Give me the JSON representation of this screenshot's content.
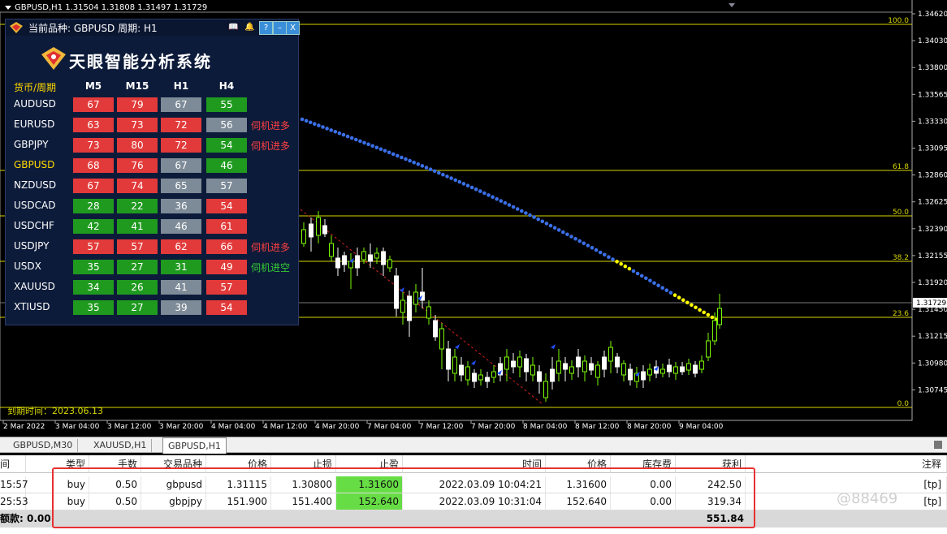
{
  "chart": {
    "header": "GBPUSD,H1  1.31504 1.31808 1.31497 1.31729",
    "price_labels": [
      "1.34620",
      "1.34030",
      "1.33800",
      "1.33565",
      "1.33330",
      "1.33095",
      "1.32860",
      "1.32625",
      "1.32390",
      "1.32155",
      "1.31920",
      "1.31729",
      "1.31450",
      "1.31215",
      "1.30980",
      "1.30745"
    ],
    "current_price": "1.31729",
    "fib_levels": [
      {
        "label": "100.0"
      },
      {
        "label": "61.8"
      },
      {
        "label": "50.0"
      },
      {
        "label": "38.2"
      },
      {
        "label": "23.6"
      },
      {
        "label": "0.0"
      }
    ],
    "time_labels": [
      "2 Mar 2022",
      "3 Mar 04:00",
      "3 Mar 12:00",
      "3 Mar 20:00",
      "4 Mar 04:00",
      "4 Mar 12:00",
      "4 Mar 20:00",
      "7 Mar 04:00",
      "7 Mar 12:00",
      "7 Mar 20:00",
      "8 Mar 04:00",
      "8 Mar 12:00",
      "8 Mar 20:00",
      "9 Mar 04:00"
    ],
    "colors": {
      "bull": "#7cfc00",
      "bear": "#ffffff",
      "fib": "#d6d600",
      "dots": "#3a6fe8",
      "dots_hi": "#ffff00",
      "trend": "#d02020"
    }
  },
  "panel": {
    "title": "当前品种: GBPUSD 周期: H1",
    "brand": "天眼智能分析系统",
    "col_header": "货币/周期",
    "columns": [
      "M5",
      "M15",
      "H1",
      "H4"
    ],
    "rows": [
      {
        "symbol": "AUDUSD",
        "cells": [
          {
            "v": "67",
            "c": "red"
          },
          {
            "v": "79",
            "c": "red"
          },
          {
            "v": "67",
            "c": "gray"
          },
          {
            "v": "55",
            "c": "green"
          }
        ],
        "note": ""
      },
      {
        "symbol": "EURUSD",
        "cells": [
          {
            "v": "63",
            "c": "red"
          },
          {
            "v": "73",
            "c": "red"
          },
          {
            "v": "72",
            "c": "red"
          },
          {
            "v": "56",
            "c": "gray"
          }
        ],
        "note": "伺机进多",
        "note_color": "#ff4040"
      },
      {
        "symbol": "GBPJPY",
        "cells": [
          {
            "v": "73",
            "c": "red"
          },
          {
            "v": "80",
            "c": "red"
          },
          {
            "v": "72",
            "c": "red"
          },
          {
            "v": "54",
            "c": "green"
          }
        ],
        "note": "伺机进多",
        "note_color": "#ff4040"
      },
      {
        "symbol": "GBPUSD",
        "cells": [
          {
            "v": "68",
            "c": "red"
          },
          {
            "v": "76",
            "c": "red"
          },
          {
            "v": "67",
            "c": "gray"
          },
          {
            "v": "46",
            "c": "green"
          }
        ],
        "note": "",
        "highlight": true
      },
      {
        "symbol": "NZDUSD",
        "cells": [
          {
            "v": "67",
            "c": "red"
          },
          {
            "v": "74",
            "c": "red"
          },
          {
            "v": "65",
            "c": "gray"
          },
          {
            "v": "57",
            "c": "gray"
          }
        ],
        "note": ""
      },
      {
        "symbol": "USDCAD",
        "cells": [
          {
            "v": "28",
            "c": "green"
          },
          {
            "v": "22",
            "c": "green"
          },
          {
            "v": "36",
            "c": "gray"
          },
          {
            "v": "54",
            "c": "red"
          }
        ],
        "note": ""
      },
      {
        "symbol": "USDCHF",
        "cells": [
          {
            "v": "42",
            "c": "green"
          },
          {
            "v": "41",
            "c": "green"
          },
          {
            "v": "46",
            "c": "gray"
          },
          {
            "v": "61",
            "c": "red"
          }
        ],
        "note": ""
      },
      {
        "symbol": "USDJPY",
        "cells": [
          {
            "v": "57",
            "c": "red"
          },
          {
            "v": "57",
            "c": "red"
          },
          {
            "v": "62",
            "c": "red"
          },
          {
            "v": "66",
            "c": "red"
          }
        ],
        "note": "伺机进多",
        "note_color": "#ff4040"
      },
      {
        "symbol": "USDX",
        "cells": [
          {
            "v": "35",
            "c": "green"
          },
          {
            "v": "27",
            "c": "green"
          },
          {
            "v": "31",
            "c": "green"
          },
          {
            "v": "49",
            "c": "red"
          }
        ],
        "note": "伺机进空",
        "note_color": "#33cc33"
      },
      {
        "symbol": "XAUUSD",
        "cells": [
          {
            "v": "34",
            "c": "green"
          },
          {
            "v": "26",
            "c": "green"
          },
          {
            "v": "41",
            "c": "gray"
          },
          {
            "v": "57",
            "c": "red"
          }
        ],
        "note": ""
      },
      {
        "symbol": "XTIUSD",
        "cells": [
          {
            "v": "35",
            "c": "green"
          },
          {
            "v": "27",
            "c": "green"
          },
          {
            "v": "39",
            "c": "gray"
          },
          {
            "v": "54",
            "c": "red"
          }
        ],
        "note": ""
      }
    ],
    "expiry": "到期时间：2023.06.13"
  },
  "tabs": [
    "GBPUSD,M30",
    "XAUUSD,H1",
    "GBPUSD,H1"
  ],
  "active_tab": 2,
  "table": {
    "headers": [
      "间",
      "类型",
      "手数",
      "交易品种",
      "价格",
      "止损",
      "止盈",
      "时间",
      "价格",
      "库存费",
      "获利",
      "注释"
    ],
    "rows": [
      [
        "15:57",
        "buy",
        "0.50",
        "gbpusd",
        "1.31115",
        "1.30800",
        "1.31600",
        "2022.03.09 10:04:21",
        "1.31600",
        "0.00",
        "242.50",
        "[tp]"
      ],
      [
        "25:53",
        "buy",
        "0.50",
        "gbpjpy",
        "151.900",
        "151.400",
        "152.640",
        "2022.03.09 10:31:04",
        "152.640",
        "0.00",
        "319.34",
        "[tp]"
      ]
    ],
    "balance_label": "额款: 0.00",
    "total_profit": "551.84"
  },
  "watermark": "@88469"
}
